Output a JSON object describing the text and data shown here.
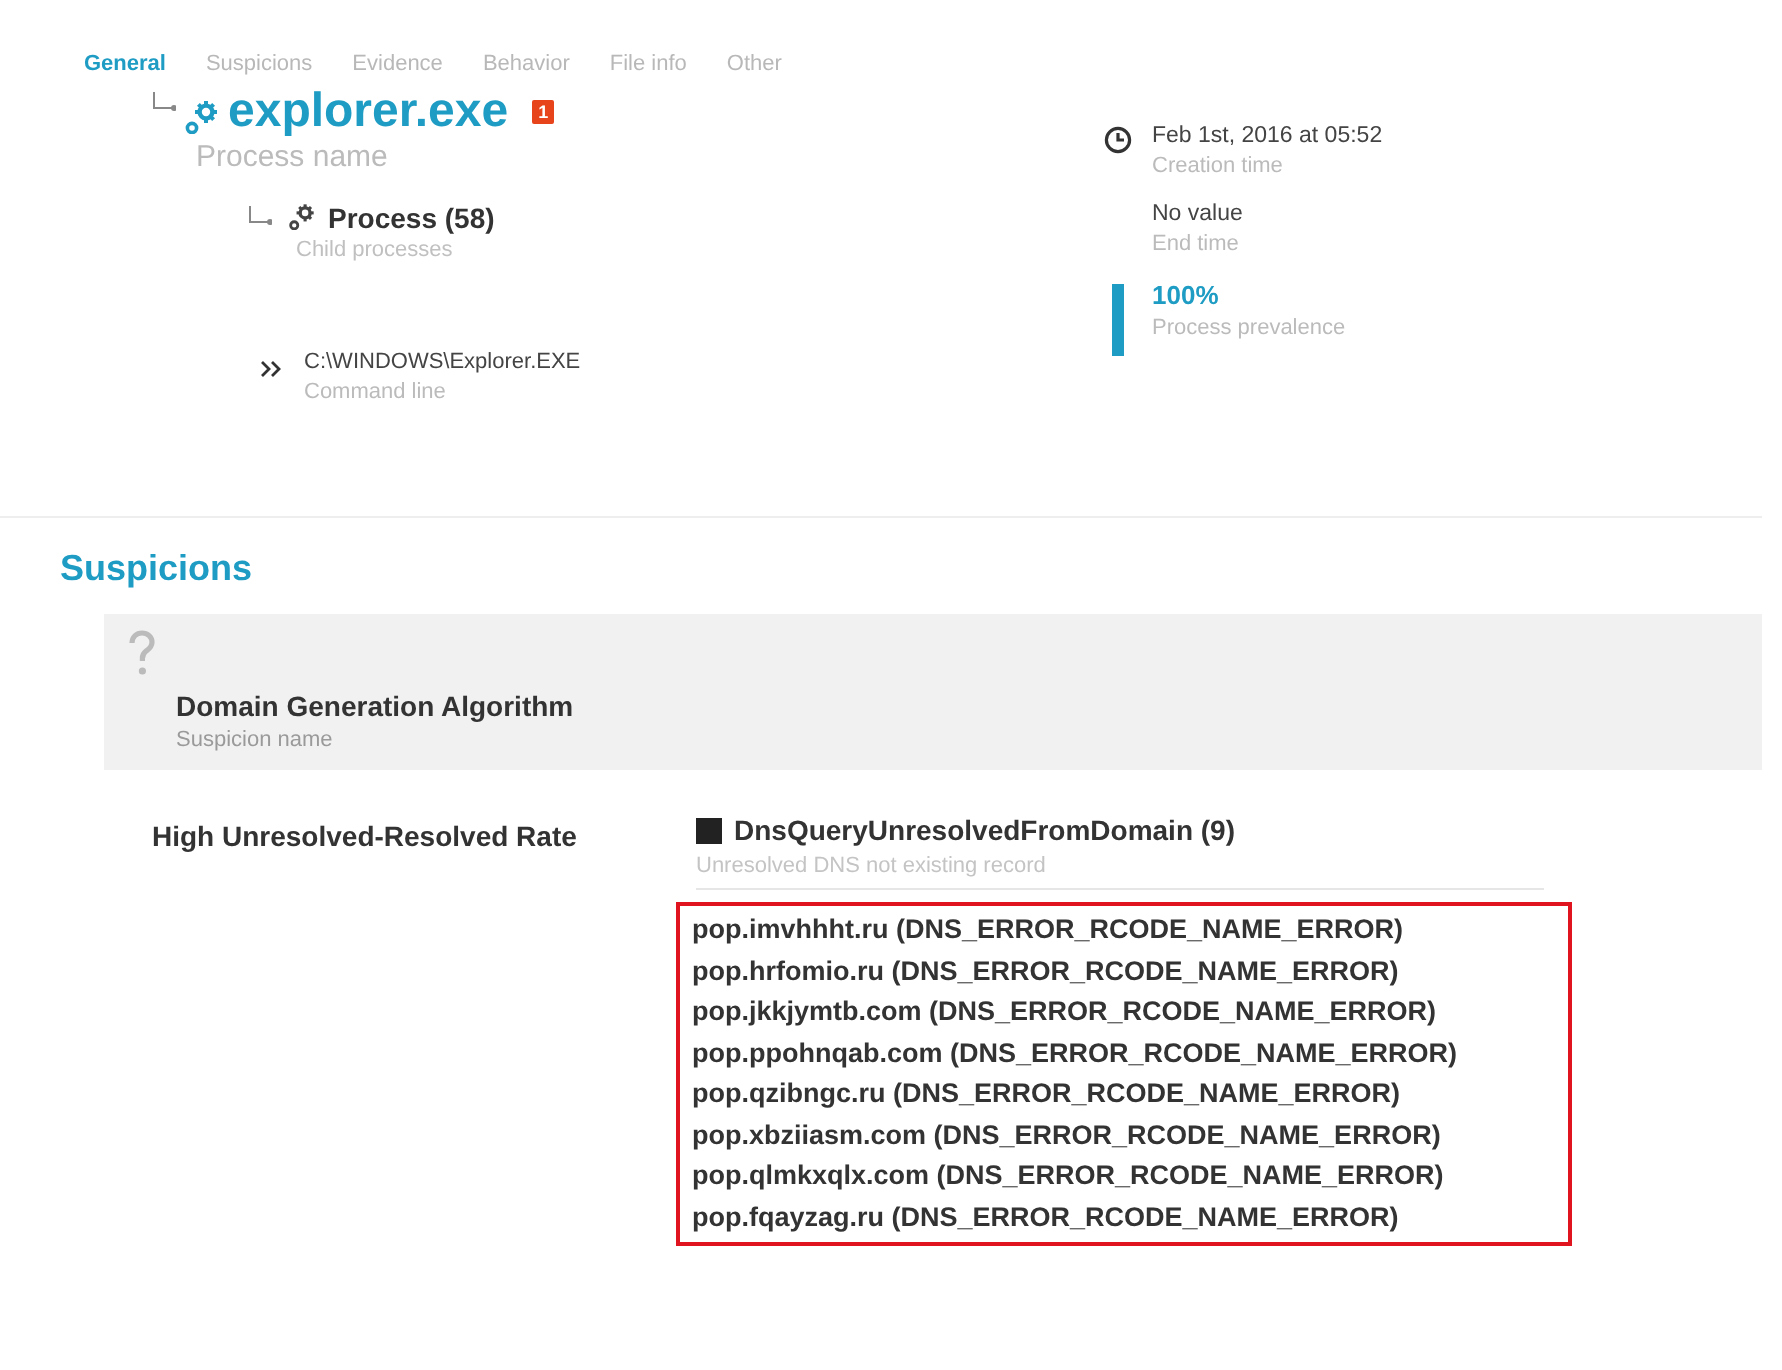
{
  "tabs": [
    {
      "label": "General",
      "selected": true
    },
    {
      "label": "Suspicions",
      "selected": false
    },
    {
      "label": "Evidence",
      "selected": false
    },
    {
      "label": "Behavior",
      "selected": false
    },
    {
      "label": "File info",
      "selected": false
    },
    {
      "label": "Other",
      "selected": false
    }
  ],
  "process": {
    "name": "explorer.exe",
    "badge": "1",
    "label": "Process name",
    "child": {
      "name": "Process (58)",
      "label": "Child processes"
    }
  },
  "details": [
    {
      "kind": "time",
      "value": "Feb 1st, 2016 at 05:52",
      "label": "Creation time"
    },
    {
      "kind": "plain",
      "value": "No value",
      "label": "End time"
    },
    {
      "kind": "prevalence",
      "value": "100%",
      "label": "Process prevalence",
      "level": 1
    }
  ],
  "command": {
    "value": "C:\\WINDOWS\\Explorer.EXE",
    "label": "Command line"
  },
  "suspicions": {
    "heading": "Suspicions",
    "items": [
      {
        "name": "Domain Generation Algorithm",
        "label": "Suspicion name",
        "rule": "High Unresolved-Resolved Rate",
        "evidence": {
          "title": "DnsQueryUnresolvedFromDomain (9)",
          "subtitle": "Unresolved DNS not existing record",
          "entries": [
            "pop.imvhhht.ru (DNS_ERROR_RCODE_NAME_ERROR)",
            "pop.hrfomio.ru (DNS_ERROR_RCODE_NAME_ERROR)",
            "pop.jkkjymtb.com (DNS_ERROR_RCODE_NAME_ERROR)",
            "pop.ppohnqab.com (DNS_ERROR_RCODE_NAME_ERROR)",
            "pop.qzibngc.ru (DNS_ERROR_RCODE_NAME_ERROR)",
            "pop.xbziiasm.com (DNS_ERROR_RCODE_NAME_ERROR)",
            "pop.qlmkxqlx.com (DNS_ERROR_RCODE_NAME_ERROR)",
            "pop.fqayzag.ru (DNS_ERROR_RCODE_NAME_ERROR)"
          ]
        }
      }
    ]
  }
}
